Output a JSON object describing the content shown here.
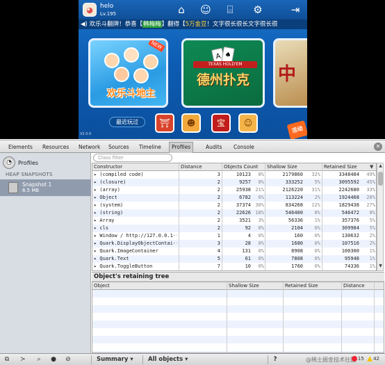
{
  "game": {
    "username": "helo",
    "level": "Lv.195",
    "marquee_parts": [
      "欢乐斗翻牌！恭喜【",
      "韩梅梅",
      "】翻得【",
      "5万金豆",
      "！文字很长很长文字很长很"
    ],
    "card_titles": [
      "欢乐斗地主",
      "德州扑克",
      "中"
    ],
    "texas_label": "TEXAS HOLD'EM",
    "new_badge": "NEW",
    "recent_button": "最近玩过",
    "version": "V2.0.0",
    "activity": "活动",
    "colors": {
      "sky": "#1b73c9",
      "topbar": "#1a66b8",
      "marquee_bg": "#0a3f7c"
    }
  },
  "devtools": {
    "tabs": [
      "Elements",
      "Resources",
      "Network",
      "Sources",
      "Timeline",
      "Profiles",
      "Audits",
      "Console"
    ],
    "active_tab": "Profiles",
    "sidebar": {
      "title": "Profiles",
      "heading": "HEAP SNAPSHOTS",
      "snapshot_name": "Snapshot 1",
      "snapshot_size": "6.5 MB"
    },
    "filter_placeholder": "Class filter",
    "heap": {
      "columns": [
        "Constructor",
        "Distance",
        "Objects Count",
        "Shallow Size",
        "Retained Size"
      ],
      "rows": [
        {
          "name": "▸ (compiled code)",
          "dist": "3",
          "count": "10123",
          "count_pct": "8%",
          "shallow": "2179860",
          "shallow_pct": "32%",
          "retained": "3348484",
          "retained_pct": "49%"
        },
        {
          "name": "▸ (closure)",
          "dist": "2",
          "count": "9257",
          "count_pct": "8%",
          "shallow": "333252",
          "shallow_pct": "5%",
          "retained": "3095592",
          "retained_pct": "45%"
        },
        {
          "name": "▸ (array)",
          "dist": "2",
          "count": "25938",
          "count_pct": "21%",
          "shallow": "2126220",
          "shallow_pct": "31%",
          "retained": "2242680",
          "retained_pct": "33%"
        },
        {
          "name": "▸ Object",
          "dist": "2",
          "count": "6782",
          "count_pct": "6%",
          "shallow": "113224",
          "shallow_pct": "2%",
          "retained": "1924468",
          "retained_pct": "28%"
        },
        {
          "name": "▸ (system)",
          "dist": "2",
          "count": "37374",
          "count_pct": "30%",
          "shallow": "834268",
          "shallow_pct": "12%",
          "retained": "1829438",
          "retained_pct": "27%"
        },
        {
          "name": "▸ (string)",
          "dist": "2",
          "count": "22626",
          "count_pct": "18%",
          "shallow": "546400",
          "shallow_pct": "8%",
          "retained": "546472",
          "retained_pct": "8%"
        },
        {
          "name": "▸ Array",
          "dist": "2",
          "count": "3521",
          "count_pct": "3%",
          "shallow": "56336",
          "shallow_pct": "1%",
          "retained": "357376",
          "retained_pct": "5%"
        },
        {
          "name": "▸ cls",
          "dist": "2",
          "count": "92",
          "count_pct": "0%",
          "shallow": "2104",
          "shallow_pct": "0%",
          "retained": "309984",
          "retained_pct": "5%"
        },
        {
          "name": "▸ Window / http://127.0.0.1···",
          "dist": "1",
          "count": "4",
          "count_pct": "0%",
          "shallow": "160",
          "shallow_pct": "0%",
          "retained": "130632",
          "retained_pct": "2%"
        },
        {
          "name": "▸ Quark.DisplayObjectContai···",
          "dist": "3",
          "count": "28",
          "count_pct": "0%",
          "shallow": "1680",
          "shallow_pct": "0%",
          "retained": "107516",
          "retained_pct": "2%"
        },
        {
          "name": "▸ Quark.ImageContainer",
          "dist": "4",
          "count": "131",
          "count_pct": "0%",
          "shallow": "8908",
          "shallow_pct": "0%",
          "retained": "100300",
          "retained_pct": "1%"
        },
        {
          "name": "▸ Quark.Text",
          "dist": "5",
          "count": "61",
          "count_pct": "0%",
          "shallow": "7808",
          "shallow_pct": "0%",
          "retained": "95948",
          "retained_pct": "1%"
        },
        {
          "name": "▸ Quark.ToggleButton",
          "dist": "7",
          "count": "10",
          "count_pct": "0%",
          "shallow": "1760",
          "shallow_pct": "0%",
          "retained": "74336",
          "retained_pct": "1%"
        }
      ]
    },
    "retaining": {
      "title": "Object's retaining tree",
      "columns": [
        "Object",
        "Shallow Size",
        "Retained Size",
        "Distance"
      ]
    },
    "statusbar": {
      "view_select": "Summary",
      "filter_select": "All objects",
      "help": "?",
      "errors": "15",
      "warnings": "42",
      "watermark": "@稀土掘金技术社区"
    }
  }
}
